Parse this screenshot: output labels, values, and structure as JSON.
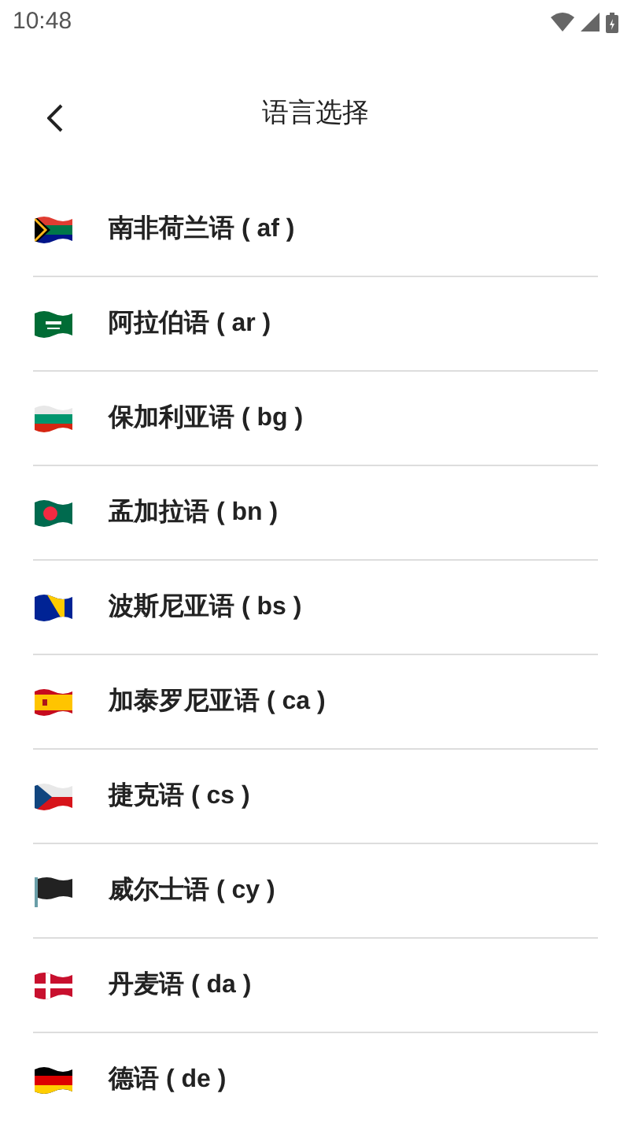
{
  "status_bar": {
    "time": "10:48"
  },
  "header": {
    "title": "语言选择"
  },
  "languages": [
    {
      "name": "南非荷兰语 ( af )"
    },
    {
      "name": "阿拉伯语 ( ar )"
    },
    {
      "name": "保加利亚语 ( bg )"
    },
    {
      "name": "孟加拉语 ( bn )"
    },
    {
      "name": "波斯尼亚语 ( bs )"
    },
    {
      "name": "加泰罗尼亚语 ( ca )"
    },
    {
      "name": "捷克语 ( cs )"
    },
    {
      "name": "威尔士语 ( cy )"
    },
    {
      "name": "丹麦语 ( da )"
    },
    {
      "name": "德语 ( de )"
    }
  ]
}
